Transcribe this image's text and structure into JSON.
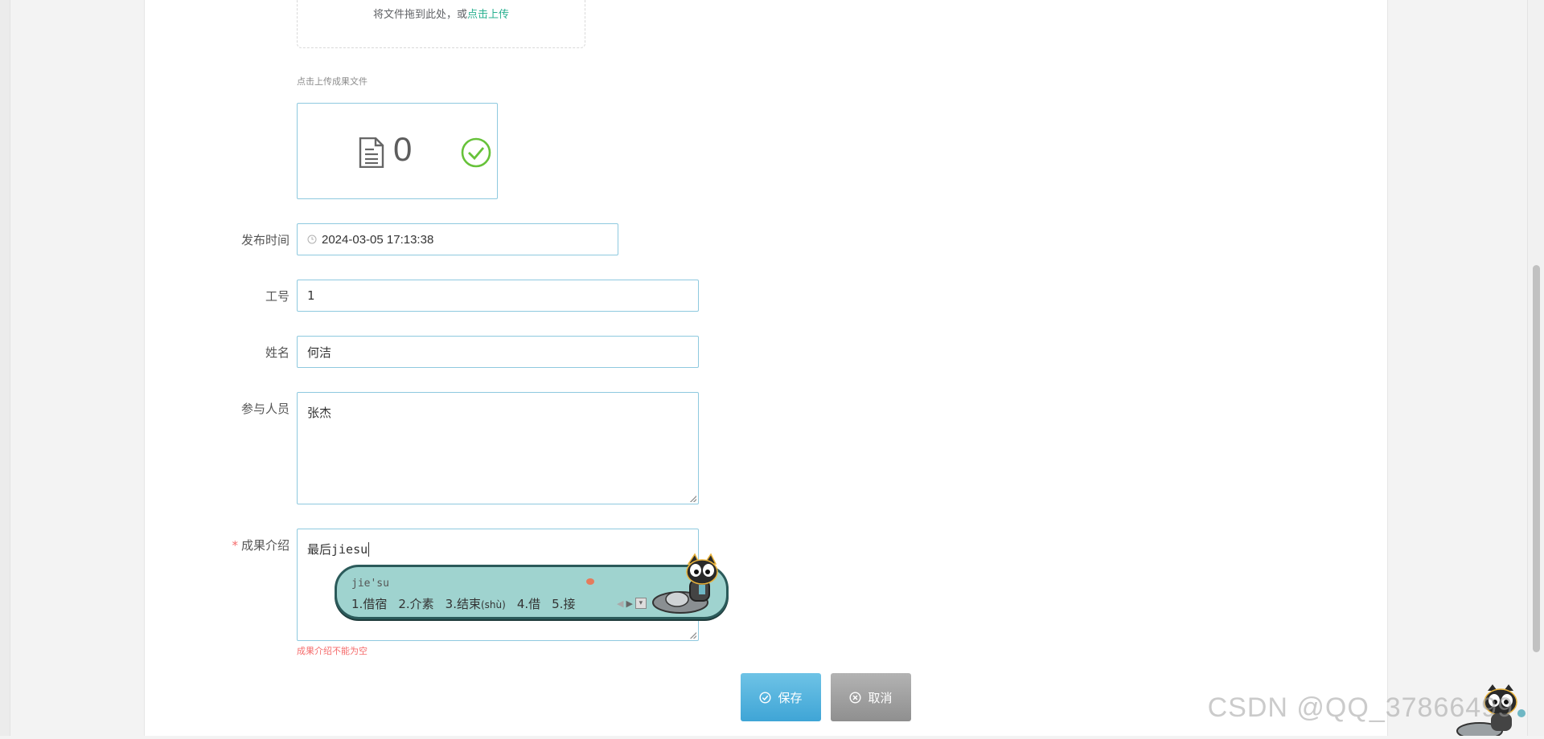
{
  "upload": {
    "drop_text": "将文件拖到此处，或",
    "drop_link": "点击上传",
    "hint": "点击上传成果文件",
    "file_count": "0"
  },
  "form": {
    "publish_time": {
      "label": "发布时间",
      "value": "2024-03-05 17:13:38"
    },
    "job_no": {
      "label": "工号",
      "value": "1"
    },
    "name": {
      "label": "姓名",
      "value": "何洁"
    },
    "participants": {
      "label": "参与人员",
      "value": "张杰"
    },
    "intro": {
      "required_mark": "*",
      "label": "成果介绍",
      "value": "最后jiesu",
      "error": "成果介绍不能为空"
    }
  },
  "buttons": {
    "save": "保存",
    "cancel": "取消"
  },
  "ime": {
    "pinyin": "jie'su",
    "candidates": [
      {
        "index": "1.",
        "text": "借宿",
        "note": ""
      },
      {
        "index": "2.",
        "text": "介素",
        "note": ""
      },
      {
        "index": "3.",
        "text": "结束",
        "note": "(shù)"
      },
      {
        "index": "4.",
        "text": "借",
        "note": ""
      },
      {
        "index": "5.",
        "text": "接",
        "note": ""
      }
    ]
  },
  "watermark": "CSDN @QQ_37866499",
  "colors": {
    "accent": "#28b08f",
    "input_border": "#8ec9df",
    "error": "#f56c6c",
    "save_button": "#4aabdb",
    "cancel_button": "#9e9e9e",
    "success_check": "#67c23a"
  }
}
